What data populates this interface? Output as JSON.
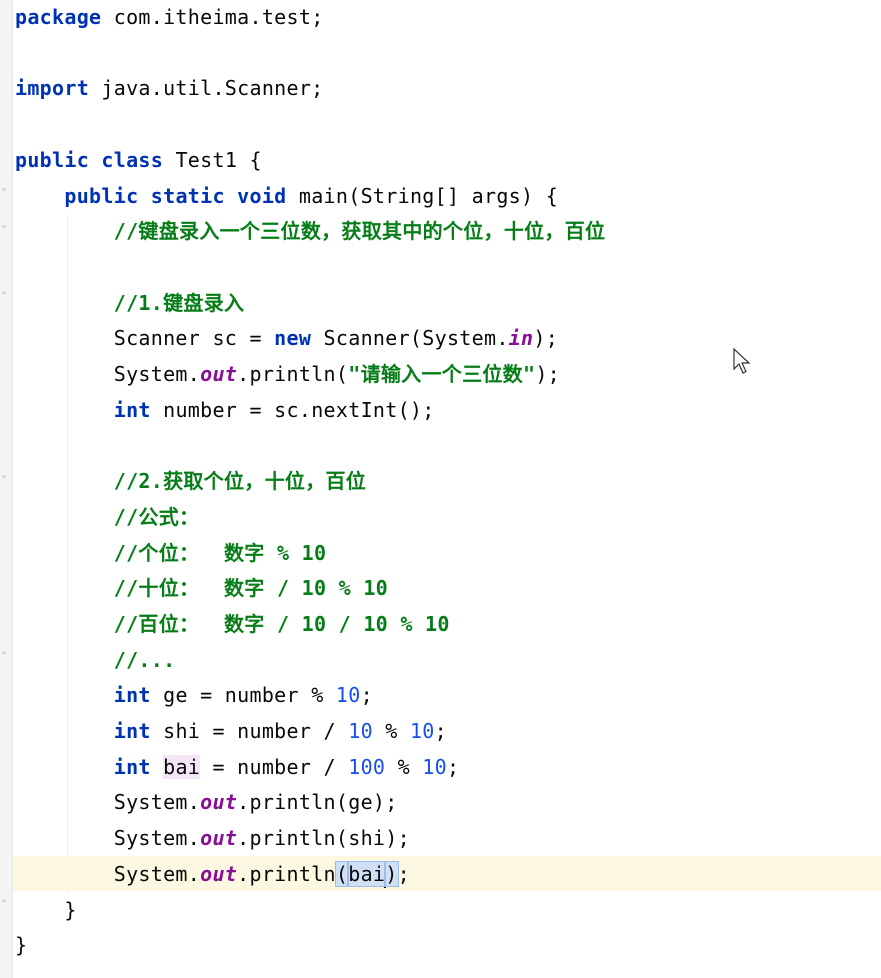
{
  "editor": {
    "lines": [
      {
        "tokens": [
          {
            "t": "package",
            "c": "kw"
          },
          {
            "t": " com.itheima.test;",
            "c": ""
          }
        ]
      },
      {
        "tokens": []
      },
      {
        "tokens": [
          {
            "t": "import",
            "c": "kw"
          },
          {
            "t": " java.util.Scanner;",
            "c": ""
          }
        ]
      },
      {
        "tokens": []
      },
      {
        "tokens": [
          {
            "t": "public",
            "c": "kw"
          },
          {
            "t": " ",
            "c": ""
          },
          {
            "t": "class",
            "c": "kw"
          },
          {
            "t": " Test1 {",
            "c": ""
          }
        ]
      },
      {
        "tokens": [
          {
            "t": "    ",
            "c": ""
          },
          {
            "t": "public",
            "c": "kw"
          },
          {
            "t": " ",
            "c": ""
          },
          {
            "t": "static",
            "c": "kw"
          },
          {
            "t": " ",
            "c": ""
          },
          {
            "t": "void",
            "c": "kw"
          },
          {
            "t": " main(String[] args) {",
            "c": ""
          }
        ]
      },
      {
        "tokens": [
          {
            "t": "        ",
            "c": ""
          },
          {
            "t": "//键盘录入一个三位数，获取其中的个位，十位，百位",
            "c": "doc"
          }
        ]
      },
      {
        "tokens": []
      },
      {
        "tokens": [
          {
            "t": "        ",
            "c": ""
          },
          {
            "t": "//1.键盘录入",
            "c": "doc"
          }
        ]
      },
      {
        "tokens": [
          {
            "t": "        Scanner sc = ",
            "c": ""
          },
          {
            "t": "new",
            "c": "kw"
          },
          {
            "t": " Scanner(System.",
            "c": ""
          },
          {
            "t": "in",
            "c": "fld"
          },
          {
            "t": ");",
            "c": ""
          }
        ]
      },
      {
        "tokens": [
          {
            "t": "        System.",
            "c": ""
          },
          {
            "t": "out",
            "c": "fld"
          },
          {
            "t": ".println(",
            "c": ""
          },
          {
            "t": "\"请输入一个三位数\"",
            "c": "str"
          },
          {
            "t": ");",
            "c": ""
          }
        ]
      },
      {
        "tokens": [
          {
            "t": "        ",
            "c": ""
          },
          {
            "t": "int",
            "c": "kw"
          },
          {
            "t": " number = sc.nextInt();",
            "c": ""
          }
        ]
      },
      {
        "tokens": []
      },
      {
        "tokens": [
          {
            "t": "        ",
            "c": ""
          },
          {
            "t": "//2.获取个位，十位，百位",
            "c": "doc"
          }
        ]
      },
      {
        "tokens": [
          {
            "t": "        ",
            "c": ""
          },
          {
            "t": "//公式：",
            "c": "doc"
          }
        ]
      },
      {
        "tokens": [
          {
            "t": "        ",
            "c": ""
          },
          {
            "t": "//个位：  数字 % 10",
            "c": "doc"
          }
        ]
      },
      {
        "tokens": [
          {
            "t": "        ",
            "c": ""
          },
          {
            "t": "//十位：  数字 / 10 % 10",
            "c": "doc"
          }
        ]
      },
      {
        "tokens": [
          {
            "t": "        ",
            "c": ""
          },
          {
            "t": "//百位：  数字 / 10 / 10 % 10",
            "c": "doc"
          }
        ]
      },
      {
        "tokens": [
          {
            "t": "        ",
            "c": ""
          },
          {
            "t": "//...",
            "c": "doc"
          }
        ]
      },
      {
        "tokens": [
          {
            "t": "        ",
            "c": ""
          },
          {
            "t": "int",
            "c": "kw"
          },
          {
            "t": " ge = number % ",
            "c": ""
          },
          {
            "t": "10",
            "c": "num"
          },
          {
            "t": ";",
            "c": ""
          }
        ]
      },
      {
        "tokens": [
          {
            "t": "        ",
            "c": ""
          },
          {
            "t": "int",
            "c": "kw"
          },
          {
            "t": " shi = number / ",
            "c": ""
          },
          {
            "t": "10",
            "c": "num"
          },
          {
            "t": " % ",
            "c": ""
          },
          {
            "t": "10",
            "c": "num"
          },
          {
            "t": ";",
            "c": ""
          }
        ]
      },
      {
        "tokens": [
          {
            "t": "        ",
            "c": ""
          },
          {
            "t": "int",
            "c": "kw"
          },
          {
            "t": " ",
            "c": ""
          },
          {
            "t": "bai",
            "c": "hl-var"
          },
          {
            "t": " = number / ",
            "c": ""
          },
          {
            "t": "100",
            "c": "num"
          },
          {
            "t": " % ",
            "c": ""
          },
          {
            "t": "10",
            "c": "num"
          },
          {
            "t": ";",
            "c": ""
          }
        ]
      },
      {
        "tokens": [
          {
            "t": "        System.",
            "c": ""
          },
          {
            "t": "out",
            "c": "fld"
          },
          {
            "t": ".println(ge);",
            "c": ""
          }
        ]
      },
      {
        "tokens": [
          {
            "t": "        System.",
            "c": ""
          },
          {
            "t": "out",
            "c": "fld"
          },
          {
            "t": ".println(shi);",
            "c": ""
          }
        ]
      },
      {
        "tokens": [
          {
            "t": "        System.",
            "c": ""
          },
          {
            "t": "out",
            "c": "fld"
          },
          {
            "t": ".println",
            "c": ""
          },
          {
            "t": "(",
            "c": "brace-match"
          },
          {
            "t": "bai",
            "c": "brace-match"
          },
          {
            "t": "|",
            "c": "caret"
          },
          {
            "t": ")",
            "c": "brace-match"
          },
          {
            "t": ";",
            "c": ""
          }
        ]
      },
      {
        "tokens": [
          {
            "t": "    }",
            "c": ""
          }
        ]
      },
      {
        "tokens": [
          {
            "t": "}",
            "c": ""
          }
        ]
      }
    ]
  },
  "colors": {
    "keyword": "#0033b3",
    "number": "#1750eb",
    "comment": "#067d17",
    "field": "#871094",
    "caret_line": "#fdf8e1"
  }
}
